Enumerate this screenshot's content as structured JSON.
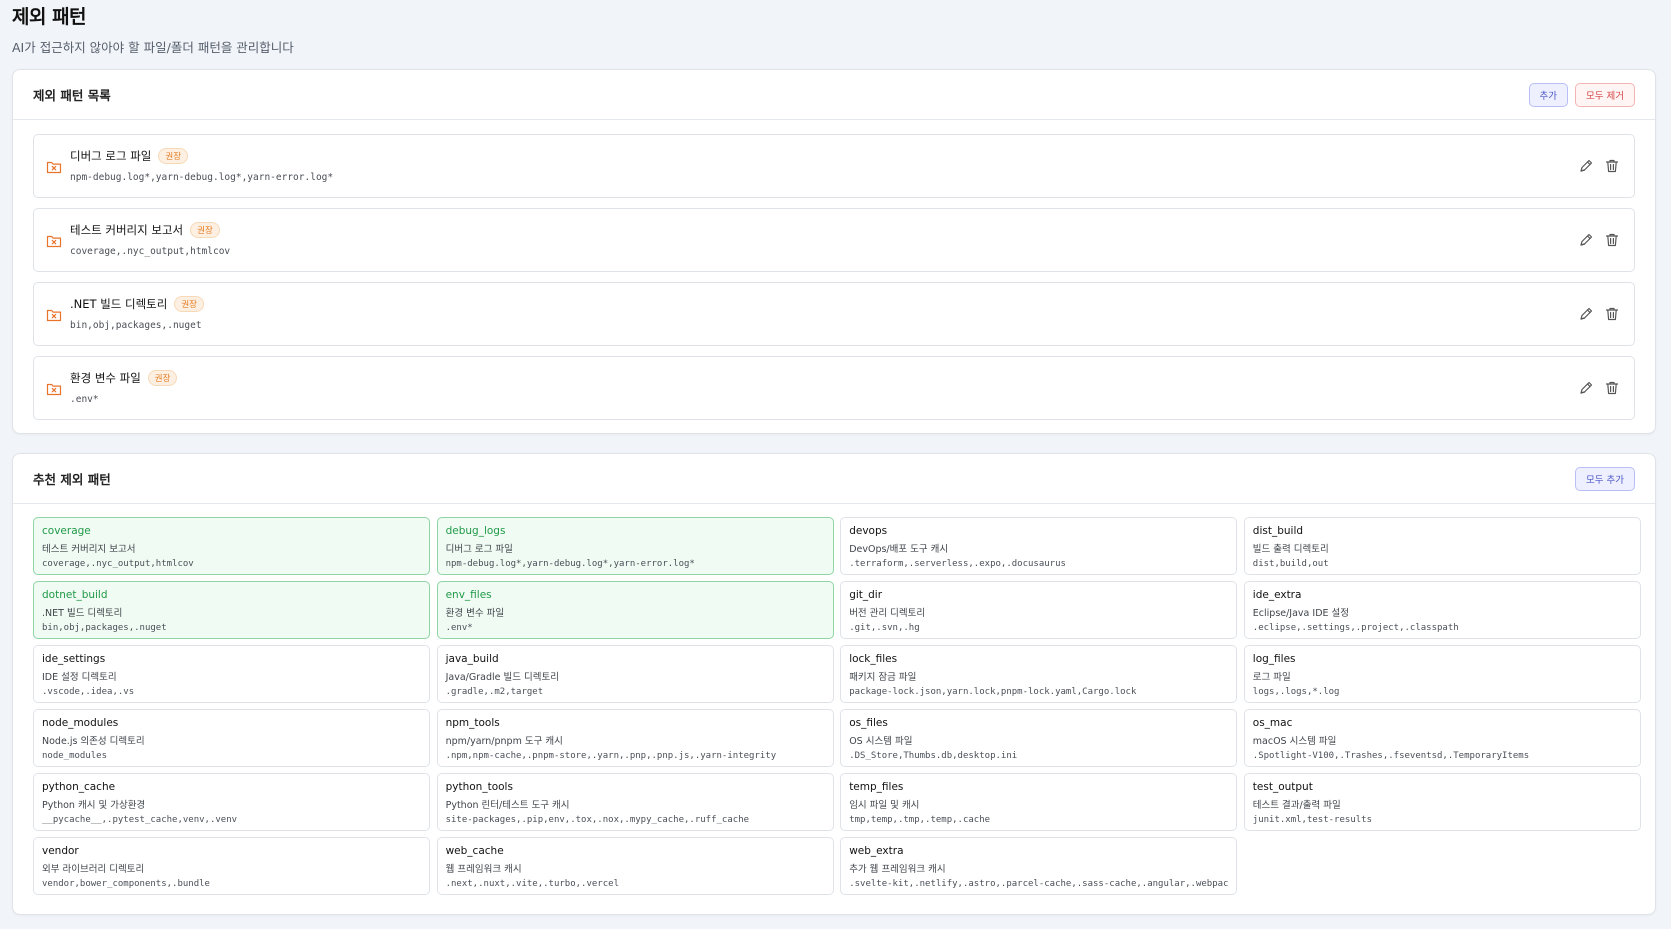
{
  "header": {
    "title": "제외 패턴",
    "subtitle": "AI가 접근하지 않아야 할 파일/폴더 패턴을 관리합니다"
  },
  "colors": {
    "accent": "#4b55c8",
    "danger": "#d64545",
    "recommended_badge": "#e27b22",
    "selected": "#1f9a48"
  },
  "exclude_section": {
    "title": "제외 패턴 목록",
    "add_label": "추가",
    "remove_all_label": "모두 제거",
    "items": [
      {
        "name": "디버그 로그 파일",
        "badge": "권장",
        "patterns": "npm-debug.log*,yarn-debug.log*,yarn-error.log*",
        "icon": "folder-x-icon"
      },
      {
        "name": "테스트 커버리지 보고서",
        "badge": "권장",
        "patterns": "coverage,.nyc_output,htmlcov",
        "icon": "folder-x-icon"
      },
      {
        "name": ".NET 빌드 디렉토리",
        "badge": "권장",
        "patterns": "bin,obj,packages,.nuget",
        "icon": "folder-x-icon"
      },
      {
        "name": "환경 변수 파일",
        "badge": "권장",
        "patterns": ".env*",
        "icon": "folder-x-icon"
      }
    ]
  },
  "recommended_section": {
    "title": "추천 제외 패턴",
    "add_all_label": "모두 추가",
    "items": [
      {
        "key": "coverage",
        "desc": "테스트 커버리지 보고서",
        "patterns": "coverage,.nyc_output,htmlcov",
        "selected": true
      },
      {
        "key": "debug_logs",
        "desc": "디버그 로그 파일",
        "patterns": "npm-debug.log*,yarn-debug.log*,yarn-error.log*",
        "selected": true
      },
      {
        "key": "devops",
        "desc": "DevOps/배포 도구 캐시",
        "patterns": ".terraform,.serverless,.expo,.docusaurus",
        "selected": false
      },
      {
        "key": "dist_build",
        "desc": "빌드 출력 디렉토리",
        "patterns": "dist,build,out",
        "selected": false
      },
      {
        "key": "dotnet_build",
        "desc": ".NET 빌드 디렉토리",
        "patterns": "bin,obj,packages,.nuget",
        "selected": true
      },
      {
        "key": "env_files",
        "desc": "환경 변수 파일",
        "patterns": ".env*",
        "selected": true
      },
      {
        "key": "git_dir",
        "desc": "버전 관리 디렉토리",
        "patterns": ".git,.svn,.hg",
        "selected": false
      },
      {
        "key": "ide_extra",
        "desc": "Eclipse/Java IDE 설정",
        "patterns": ".eclipse,.settings,.project,.classpath",
        "selected": false
      },
      {
        "key": "ide_settings",
        "desc": "IDE 설정 디렉토리",
        "patterns": ".vscode,.idea,.vs",
        "selected": false
      },
      {
        "key": "java_build",
        "desc": "Java/Gradle 빌드 디렉토리",
        "patterns": ".gradle,.m2,target",
        "selected": false
      },
      {
        "key": "lock_files",
        "desc": "패키지 잠금 파일",
        "patterns": "package-lock.json,yarn.lock,pnpm-lock.yaml,Cargo.lock",
        "selected": false
      },
      {
        "key": "log_files",
        "desc": "로그 파일",
        "patterns": "logs,.logs,*.log",
        "selected": false
      },
      {
        "key": "node_modules",
        "desc": "Node.js 의존성 디렉토리",
        "patterns": "node_modules",
        "selected": false
      },
      {
        "key": "npm_tools",
        "desc": "npm/yarn/pnpm 도구 캐시",
        "patterns": ".npm,npm-cache,.pnpm-store,.yarn,.pnp,.pnp.js,.yarn-integrity",
        "selected": false
      },
      {
        "key": "os_files",
        "desc": "OS 시스템 파일",
        "patterns": ".DS_Store,Thumbs.db,desktop.ini",
        "selected": false
      },
      {
        "key": "os_mac",
        "desc": "macOS 시스템 파일",
        "patterns": ".Spotlight-V100,.Trashes,.fseventsd,.TemporaryItems",
        "selected": false
      },
      {
        "key": "python_cache",
        "desc": "Python 캐시 및 가상환경",
        "patterns": "__pycache__,.pytest_cache,venv,.venv",
        "selected": false
      },
      {
        "key": "python_tools",
        "desc": "Python 린터/테스트 도구 캐시",
        "patterns": "site-packages,.pip,env,.tox,.nox,.mypy_cache,.ruff_cache",
        "selected": false
      },
      {
        "key": "temp_files",
        "desc": "임시 파일 및 캐시",
        "patterns": "tmp,temp,.tmp,.temp,.cache",
        "selected": false
      },
      {
        "key": "test_output",
        "desc": "테스트 결과/출력 파일",
        "patterns": "junit.xml,test-results",
        "selected": false
      },
      {
        "key": "vendor",
        "desc": "외부 라이브러리 디렉토리",
        "patterns": "vendor,bower_components,.bundle",
        "selected": false
      },
      {
        "key": "web_cache",
        "desc": "웹 프레임워크 캐시",
        "patterns": ".next,.nuxt,.vite,.turbo,.vercel",
        "selected": false
      },
      {
        "key": "web_extra",
        "desc": "추가 웹 프레임워크 캐시",
        "patterns": ".svelte-kit,.netlify,.astro,.parcel-cache,.sass-cache,.angular,.webpack",
        "selected": false
      }
    ]
  }
}
